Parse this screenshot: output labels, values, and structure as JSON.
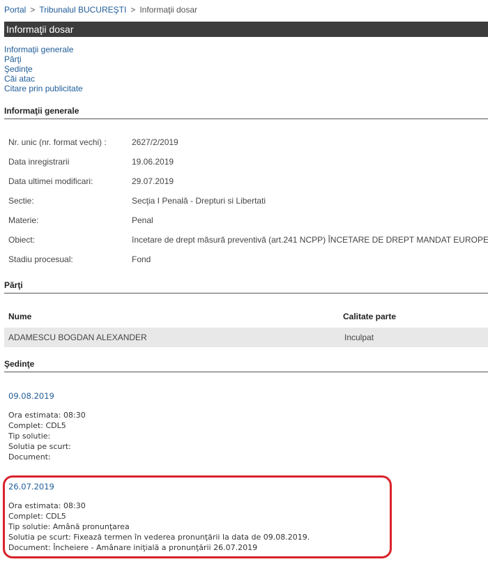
{
  "breadcrumb": {
    "portal": "Portal",
    "sep1": ">",
    "court": "Tribunalul BUCUREŞTI",
    "sep2": ">",
    "current": "Informaţii dosar"
  },
  "title": "Informaţii dosar",
  "nav": [
    "Informaţii generale",
    "Părţi",
    "Şedinţe",
    "Căi atac",
    "Citare prin publicitate"
  ],
  "general": {
    "heading": "Informaţii generale",
    "rows": [
      {
        "label": "Nr. unic (nr. format vechi) :",
        "value": "2627/2/2019"
      },
      {
        "label": "Data inregistrarii",
        "value": "19.06.2019"
      },
      {
        "label": "Data ultimei modificari:",
        "value": "29.07.2019"
      },
      {
        "label": "Sectie:",
        "value": "Secţia I Penală - Drepturi si Libertati"
      },
      {
        "label": "Materie:",
        "value": "Penal"
      },
      {
        "label": "Obiect:",
        "value": "încetare de drept măsură preventivă (art.241 NCPP) ÎNCETARE DE DREPT MANDAT EUROPEAN"
      },
      {
        "label": "Stadiu procesual:",
        "value": "Fond"
      }
    ]
  },
  "parti": {
    "heading": "Părţi",
    "columns": [
      "Nume",
      "Calitate parte"
    ],
    "rows": [
      {
        "nume": "ADAMESCU BOGDAN ALEXANDER",
        "calitate": "Inculpat"
      }
    ]
  },
  "sedinte": {
    "heading": "Şedinţe",
    "items": [
      {
        "date": "09.08.2019",
        "lines": [
          "Ora estimata: 08:30",
          "Complet: CDL5",
          "Tip solutie:",
          "Solutia pe scurt:",
          "Document:"
        ]
      },
      {
        "date": "26.07.2019",
        "lines": [
          "Ora estimata: 08:30",
          "Complet: CDL5",
          "Tip solutie: Amână pronunţarea",
          "Solutia pe scurt: Fixează termen în vederea pronunţării la data de 09.08.2019.",
          "Document: Încheiere - Amânare iniţială a pronunţării    26.07.2019"
        ]
      }
    ]
  },
  "colors": {
    "link": "#1f5c99",
    "titlebar": "#3c3c3c",
    "highlight": "#d9222a",
    "row_bg": "#e8e8e8"
  }
}
